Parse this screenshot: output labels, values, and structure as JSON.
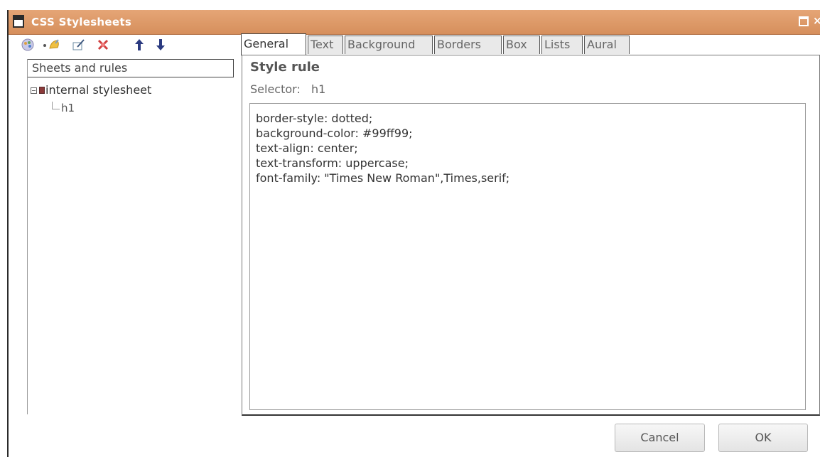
{
  "window": {
    "title": "CSS Stylesheets",
    "colors": {
      "titlebar": "#d9955f",
      "title_text": "#ffffff"
    }
  },
  "toolbar": {
    "icons": [
      "add-sheet-icon",
      "dropdown-arrow-icon",
      "add-rule-icon",
      "edit-icon",
      "delete-icon",
      "move-up-icon",
      "move-down-icon"
    ]
  },
  "tree": {
    "header": "Sheets and rules",
    "items": [
      {
        "label": "internal stylesheet",
        "expanded": true
      },
      {
        "label": "h1"
      }
    ]
  },
  "tabs": [
    {
      "label": "General",
      "active": true
    },
    {
      "label": "Text"
    },
    {
      "label": "Background"
    },
    {
      "label": "Borders"
    },
    {
      "label": "Box"
    },
    {
      "label": "Lists"
    },
    {
      "label": "Aural"
    }
  ],
  "content": {
    "heading": "Style rule",
    "selector_label": "Selector:",
    "selector_value": "h1",
    "css_lines": [
      "border-style: dotted;",
      "background-color: #99ff99;",
      "text-align: center;",
      "text-transform: uppercase;",
      "font-family: \"Times New Roman\",Times,serif;"
    ]
  },
  "buttons": {
    "cancel": "Cancel",
    "ok": "OK"
  }
}
